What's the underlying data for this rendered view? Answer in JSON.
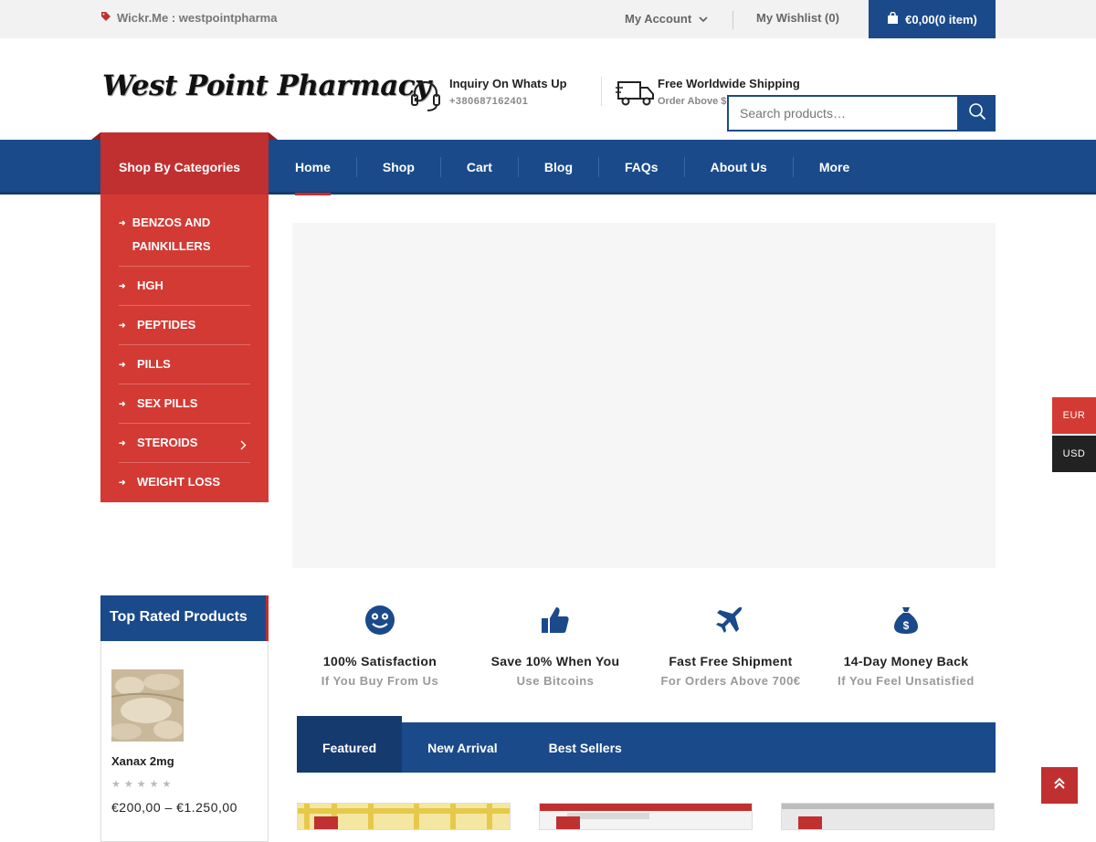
{
  "topbar": {
    "wickr": "Wickr.Me : westpointpharma",
    "account": "My Account",
    "wishlist": "My Wishlist (0)",
    "cart": "€0,00(0 item)"
  },
  "logo": "West Point Pharmacy",
  "inquiry": {
    "title": "Inquiry On Whats Up",
    "phone": "+380687162401"
  },
  "shipping": {
    "title": "Free Worldwide Shipping",
    "sub": "Order Above $"
  },
  "search": {
    "placeholder": "Search products…"
  },
  "categories": {
    "heading": "Shop By Categories",
    "items": [
      {
        "label": "BENZOS AND PAINKILLERS"
      },
      {
        "label": "HGH"
      },
      {
        "label": "PEPTIDES"
      },
      {
        "label": "PILLS"
      },
      {
        "label": "SEX PILLS"
      },
      {
        "label": "STEROIDS"
      },
      {
        "label": "WEIGHT LOSS"
      }
    ]
  },
  "nav": {
    "items": [
      "Home",
      "Shop",
      "Cart",
      "Blog",
      "FAQs",
      "About Us",
      "More"
    ]
  },
  "top_rated": {
    "heading": "Top Rated Products",
    "product": {
      "name": "Xanax 2mg",
      "price": "€200,00 – €1.250,00"
    }
  },
  "features": [
    {
      "title": "100% Satisfaction",
      "sub": "If You Buy From Us",
      "icon": "smiley-icon"
    },
    {
      "title": "Save 10% When You",
      "sub": "Use Bitcoins",
      "icon": "thumbs-up-icon"
    },
    {
      "title": "Fast Free Shipment",
      "sub": "For Orders Above 700€",
      "icon": "airplane-icon"
    },
    {
      "title": "14-Day Money Back",
      "sub": "If You Feel Unsatisfied",
      "icon": "money-bag-icon"
    }
  ],
  "tabs": [
    "Featured",
    "New Arrival",
    "Best Sellers"
  ],
  "currency": {
    "eur": "EUR",
    "usd": "USD"
  },
  "colors": {
    "primary": "#1a4a8a",
    "accent": "#c03030",
    "eur_bg": "#d33a34",
    "usd_bg": "#222222"
  }
}
